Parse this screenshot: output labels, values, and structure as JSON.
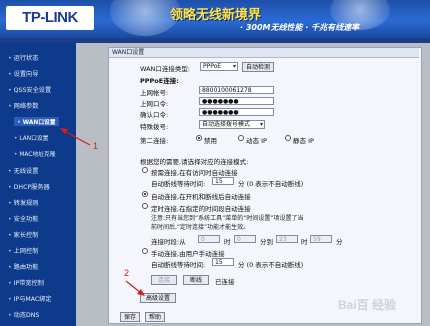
{
  "header": {
    "logo": "TP-LINK",
    "slogan_main": "领略无线新境界",
    "slogan_sub": "· 300M无线性能 · 千兆有线速率"
  },
  "sidebar": {
    "items": [
      {
        "label": "运行状态"
      },
      {
        "label": "设置向导"
      },
      {
        "label": "QSS安全设置"
      },
      {
        "label": "网络参数"
      },
      {
        "label": "WAN口设置"
      },
      {
        "label": "LAN口设置"
      },
      {
        "label": "MAC地址克隆"
      },
      {
        "label": "无线设置"
      },
      {
        "label": "DHCP服务器"
      },
      {
        "label": "转发规则"
      },
      {
        "label": "安全功能"
      },
      {
        "label": "家长控制"
      },
      {
        "label": "上网控制"
      },
      {
        "label": "路由功能"
      },
      {
        "label": "IP带宽控制"
      },
      {
        "label": "IP与MAC绑定"
      },
      {
        "label": "动态DNS"
      }
    ]
  },
  "panel": {
    "title": "WAN口设置",
    "wan_type_label": "WAN口连接类型:",
    "wan_type_value": "PPPoE",
    "auto_detect": "自动检测",
    "pppoe_header": "PPPoE连接:",
    "username_label": "上网帐号:",
    "username_value": "8800100061278",
    "password_label": "上网口令:",
    "password_value": "●●●●●●●",
    "confirm_label": "确认口令:",
    "confirm_value": "●●●●●●●",
    "dial_mode_label": "特殊拨号:",
    "dial_mode_value": "自动选择拨号模式",
    "second_conn_label": "第二连接:",
    "second_conn_options": [
      "禁用",
      "动态 IP",
      "静态 IP"
    ],
    "mode_intro": "根据您的需要,请选择对应的连接模式:",
    "opt_on_demand": "按需连接,在有访问时自动连接",
    "idle_label_1": "自动断线等待时间:",
    "idle_value_1": "15",
    "idle_unit_1": "分 (0 表示不自动断线)",
    "opt_auto": "自动连接,在开机和断线后自动连接",
    "opt_timed": "定时连接,在指定的时间段自动连接",
    "timed_note": "注意:只有当您到“系统工具”菜单的“时间设置”项设置了当前时间后,“定时连接”功能才能生效。",
    "period_label": "连接时段:从",
    "period_from_h": "0",
    "period_h": "时",
    "period_from_m": "0",
    "period_to": "分到",
    "period_to_h": "23",
    "period_to_m": "59",
    "period_m": "分",
    "opt_manual": "手动连接,由用户手动连接",
    "idle_label_2": "自动断线等待时间:",
    "idle_value_2": "15",
    "idle_unit_2": "分 (0 表示不自动断线)",
    "connect_btn": "连接",
    "disconnect_btn": "断线",
    "status_text": "已连接",
    "advanced_btn": "高级设置",
    "save_btn": "保存",
    "help_btn": "帮助"
  },
  "annotations": {
    "num1": "1",
    "num2": "2",
    "color": "#d81c1c"
  },
  "watermark": "Bai百 经验"
}
